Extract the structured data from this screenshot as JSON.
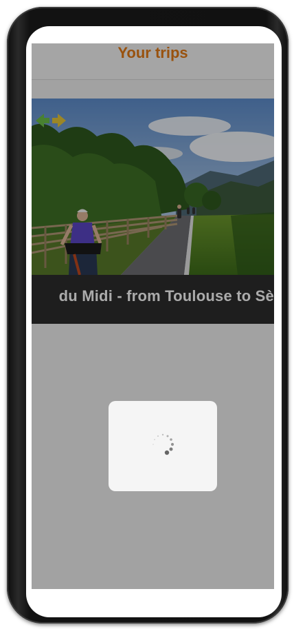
{
  "header": {
    "title": "Your trips",
    "title_color": "#E47B16"
  },
  "trips": [
    {
      "caption": "du Midi - from Toulouse to Sè",
      "image_alt": "Cyclists on a paved path beside a wooden fence and trees, mountains in the distance"
    }
  ],
  "brand": {
    "icon": "green-double-arrow-logo",
    "color": "#6CC04A"
  },
  "loading": {
    "visible": true,
    "icon": "activity-spinner-icon"
  },
  "colors": {
    "overlay": "rgba(0,0,0,0.33)",
    "background": "#F2F2F2",
    "loader_box": "#F5F5F5"
  }
}
